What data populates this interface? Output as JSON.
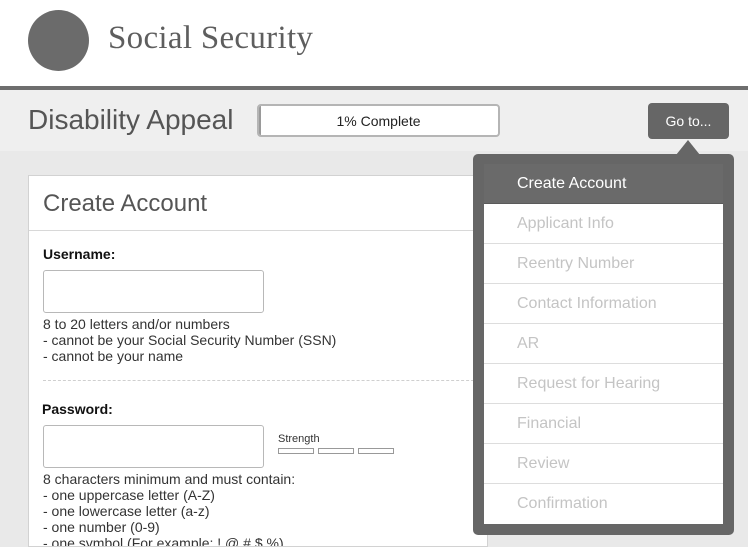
{
  "header": {
    "brand": "Social Security"
  },
  "toolbar": {
    "title": "Disability Appeal",
    "progress_text": "1% Complete",
    "progress_value": 0.01,
    "goto_label": "Go to..."
  },
  "card": {
    "title": "Create Account",
    "username": {
      "label": "Username:",
      "value": "",
      "hints": [
        "8 to 20 letters and/or numbers",
        "- cannot be your Social Security Number (SSN)",
        "- cannot be your name"
      ]
    },
    "password": {
      "label": "Password:",
      "value": "",
      "strength_label": "Strength",
      "hints": [
        "8 characters minimum and must contain:",
        "- one uppercase letter (A-Z)",
        "- one lowercase letter (a-z)",
        "- one number (0-9)",
        "- one symbol (For example: ! @ # $ %)"
      ]
    }
  },
  "menu": {
    "items": [
      {
        "label": "Create Account",
        "active": true
      },
      {
        "label": "Applicant Info",
        "active": false
      },
      {
        "label": "Reentry Number",
        "active": false
      },
      {
        "label": "Contact Information",
        "active": false
      },
      {
        "label": "AR",
        "active": false
      },
      {
        "label": "Request for Hearing",
        "active": false
      },
      {
        "label": "Financial",
        "active": false
      },
      {
        "label": "Review",
        "active": false
      },
      {
        "label": "Confirmation",
        "active": false
      }
    ]
  },
  "colors": {
    "header_rule": "#6e6e6e",
    "button": "#666666",
    "menu_active": "#6a6a6a",
    "menu_inactive_text": "#c4c4c4"
  },
  "icons": {
    "logo": "circle-logo-icon"
  }
}
